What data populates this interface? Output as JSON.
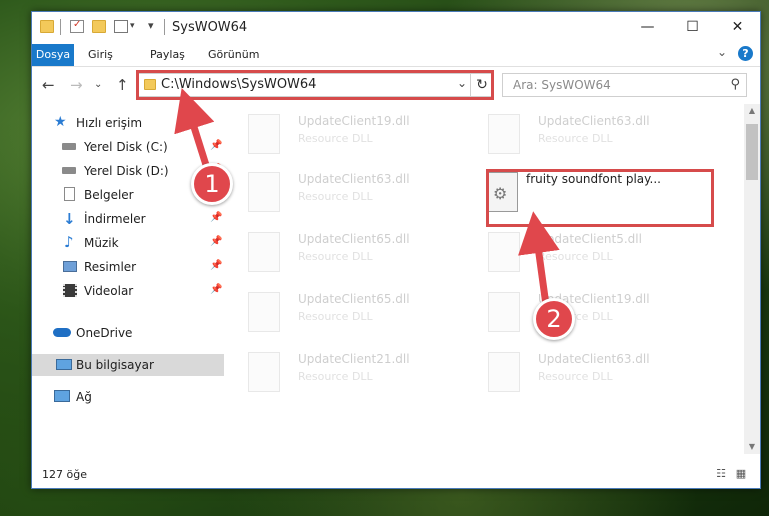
{
  "window": {
    "title": "SysWOW64",
    "controls": {
      "minimize": "—",
      "maximize": "☐",
      "close": "✕"
    }
  },
  "ribbon": {
    "tabs": [
      {
        "label": "Dosya",
        "active": true
      },
      {
        "label": "Giriş"
      },
      {
        "label": "Paylaş"
      },
      {
        "label": "Görünüm"
      }
    ],
    "help": "?",
    "expand": "⌄"
  },
  "navbar": {
    "back": "←",
    "forward": "→",
    "recent": "⌄",
    "up": "↑",
    "address": "C:\\Windows\\SysWOW64",
    "address_dropdown": "⌄",
    "refresh": "↻",
    "search_placeholder": "Ara: SysWOW64",
    "search_icon": "⚲"
  },
  "sidebar": {
    "items": [
      {
        "label": "Hızlı erişim",
        "icon": "star-icon"
      },
      {
        "label": "Yerel Disk (C:)",
        "icon": "drive-icon",
        "pin": "📌"
      },
      {
        "label": "Yerel Disk (D:)",
        "icon": "drive-icon",
        "pin": "📌"
      },
      {
        "label": "Belgeler",
        "icon": "documents-icon",
        "pin": "📌"
      },
      {
        "label": "İndirmeler",
        "icon": "download-icon",
        "pin": "📌"
      },
      {
        "label": "Müzik",
        "icon": "music-icon",
        "pin": "📌"
      },
      {
        "label": "Resimler",
        "icon": "pictures-icon",
        "pin": "📌"
      },
      {
        "label": "Videolar",
        "icon": "videos-icon",
        "pin": "📌"
      },
      {
        "label": "OneDrive",
        "icon": "cloud-icon"
      },
      {
        "label": "Bu bilgisayar",
        "icon": "computer-icon",
        "selected": true
      },
      {
        "label": "Ağ",
        "icon": "network-icon"
      }
    ]
  },
  "files": [
    {
      "name": "UpdateClient19.dll",
      "type": "Resource DLL"
    },
    {
      "name": "UpdateClient63.dll",
      "type": "Resource DLL"
    },
    {
      "name": "UpdateClient63.dll",
      "type": "Resource DLL"
    },
    {
      "name": "fruity soundfont play...",
      "type": "",
      "highlighted": true
    },
    {
      "name": "UpdateClient65.dll",
      "type": "Resource DLL"
    },
    {
      "name": "UpdateClient5.dll",
      "type": "Resource DLL"
    },
    {
      "name": "UpdateClient65.dll",
      "type": "Resource DLL"
    },
    {
      "name": "UpdateClient19.dll",
      "type": "Resource DLL"
    },
    {
      "name": "UpdateClient21.dll",
      "type": "Resource DLL"
    },
    {
      "name": "UpdateClient63.dll",
      "type": "Resource DLL"
    }
  ],
  "status": {
    "count": "127 öğe",
    "view_details": "☷",
    "view_icons": "▦"
  },
  "annotations": {
    "step1": "1",
    "step2": "2",
    "color": "#d64b4b"
  }
}
